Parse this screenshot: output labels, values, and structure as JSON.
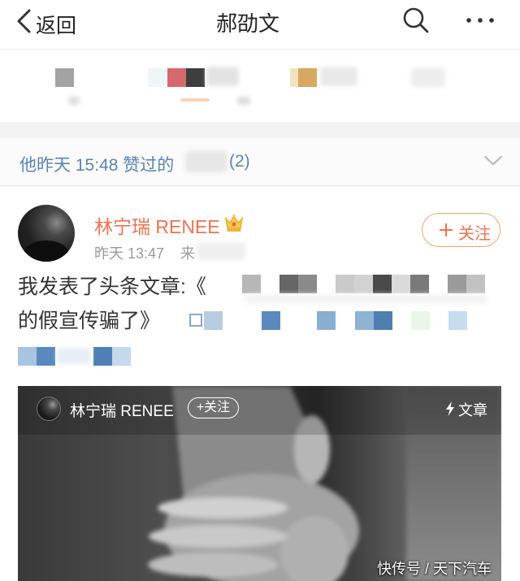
{
  "nav": {
    "back_label": "返回",
    "title": "郝劭文",
    "back_icon": "chevron-left-icon",
    "search_icon": "search-icon",
    "more_icon": "more-dots-icon"
  },
  "liked": {
    "prefix": "他昨天 15:48 赞过的",
    "count": "(2)",
    "expand_icon": "chevron-down-icon"
  },
  "post": {
    "username": "林宁瑞 RENEE",
    "badge_icon": "crown-icon",
    "time": "昨天 13:47",
    "source_prefix": "来",
    "follow_icon": "plus-icon",
    "follow_label": "关注",
    "text_line1": "我发表了头条文章:《",
    "text_line2": "的假宣传骗了》",
    "link_icon": "link-icon"
  },
  "article_card": {
    "author": "林宁瑞 RENEE",
    "follow_label": "+关注",
    "type_icon": "lightning-icon",
    "type_label": "文章",
    "watermark": "快传号 / 天下汽车"
  },
  "colors": {
    "username": "#eb7350",
    "link": "#5b84b1",
    "meta": "#9b9b9b",
    "body": "#333333",
    "sep": "#f3f3f3"
  }
}
